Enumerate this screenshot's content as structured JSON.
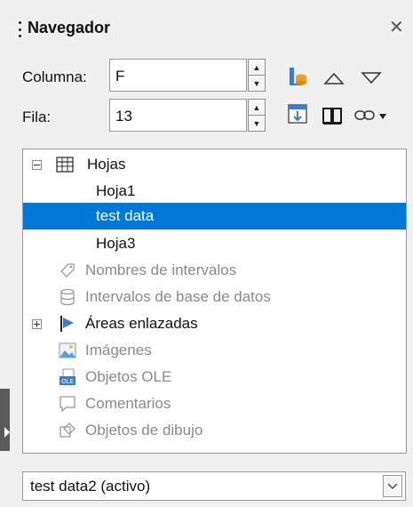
{
  "header": {
    "title": "Navegador"
  },
  "column": {
    "label": "Columna:",
    "value": "F"
  },
  "row": {
    "label": "Fila:",
    "value": "13"
  },
  "tree": {
    "items": [
      {
        "label": "Hojas"
      },
      {
        "label": "Hoja1"
      },
      {
        "label": "test data"
      },
      {
        "label": "Hoja3"
      },
      {
        "label": "Nombres de intervalos"
      },
      {
        "label": "Intervalos de base de datos"
      },
      {
        "label": "Áreas enlazadas"
      },
      {
        "label": "Imágenes"
      },
      {
        "label": "Objetos OLE"
      },
      {
        "label": "Comentarios"
      },
      {
        "label": "Objetos de dibujo"
      }
    ]
  },
  "document_select": {
    "value": "test data2 (activo)"
  },
  "colors": {
    "accent": "#0078d7",
    "muted": "#8a8a8a"
  },
  "icons": [
    "sidebar-grip-icon",
    "close-icon",
    "content-toggle-icon",
    "up-triangle-icon",
    "down-triangle-icon",
    "data-range-icon",
    "book-icon",
    "link-icon",
    "dropdown-arrow-icon",
    "sheet-grid-icon",
    "flag-icon",
    "image-icon",
    "ole-icon",
    "comment-icon",
    "drawing-icon",
    "tag-icon",
    "database-icon"
  ]
}
